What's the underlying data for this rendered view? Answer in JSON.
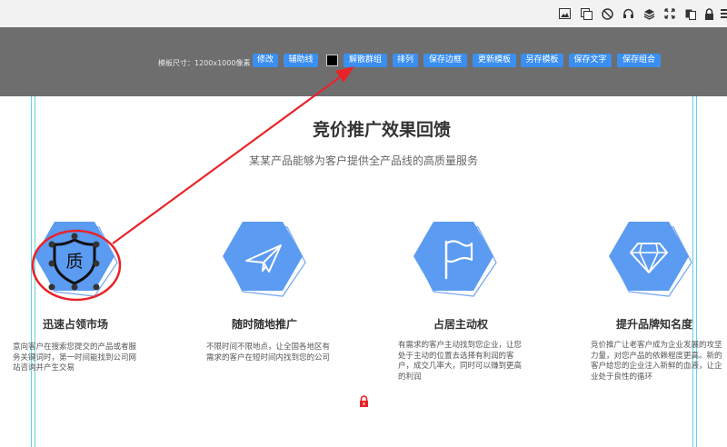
{
  "browser_toolbar": {
    "icons": [
      "image-icon",
      "copy-icon",
      "ban-icon",
      "headset-icon",
      "layers-icon",
      "fullscreen-icon",
      "paste-icon",
      "lock-icon",
      "menu-icon"
    ]
  },
  "editor_toolbar": {
    "size_label": "模板尺寸：1200x1000像素",
    "buttons": {
      "modify": "修改",
      "guideline": "辅助线",
      "ungroup": "解散群组",
      "arrange": "排列",
      "save_border": "保存边框",
      "update_template": "更新模板",
      "save_as_template": "另存模板",
      "save_text": "保存文字",
      "save_group": "保存组合"
    },
    "color_swatch": "#000000",
    "button_color": "#3b8ff0"
  },
  "section": {
    "title": "竞价推广效果回馈",
    "subtitle": "某某产品能够为客户提供全产品线的高质量服务"
  },
  "features": [
    {
      "icon": "quality-shield-icon",
      "glyph": "质",
      "title": "迅速占领市场",
      "desc": "意向客户在搜索您提交的产品或者服务关键词时，第一时间能找到公司网站咨询并产生交易"
    },
    {
      "icon": "paper-plane-icon",
      "title": "随时随地推广",
      "desc": "不限时间不限地点，让全国各地区有需求的客户在短时间内找到您的公司"
    },
    {
      "icon": "flag-icon",
      "title": "占居主动权",
      "desc": "有需求的客户主动找到您企业，让您处于主动的位置去选择有利润的客户，成交几率大，同时可以赚到更高的利润"
    },
    {
      "icon": "diamond-icon",
      "title": "提升品牌知名度",
      "desc": "竞价推广让老客户成为企业发展的攻坚力量，对您产品的依赖程度更高。新的客户给您的企业注入新鲜的血液，让企业处于良性的循环"
    }
  ],
  "colors": {
    "hexagon": "#5b9bf2",
    "hexagon_outline": "#7aa9f4",
    "annotation": "#e8232a",
    "guide": "#5fd3e4"
  }
}
